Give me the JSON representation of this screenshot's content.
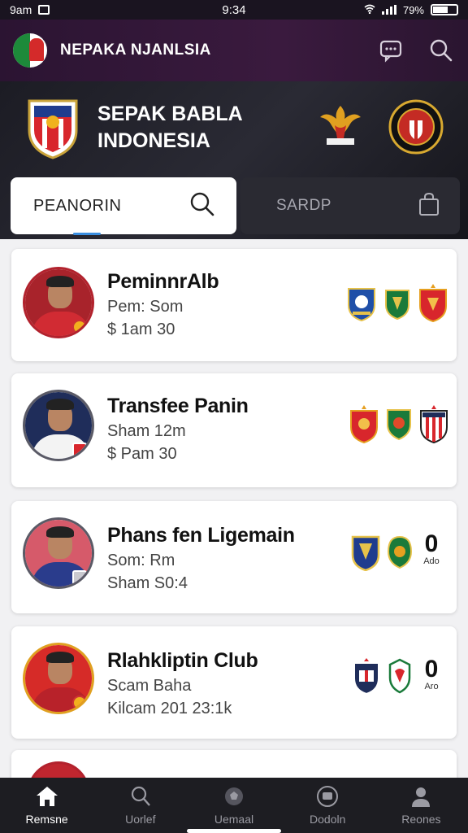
{
  "status_bar": {
    "carrier": "9am",
    "time": "9:34",
    "battery": "79%"
  },
  "app_bar": {
    "title": "NEPAKA NJANLSIA",
    "logo_icon": "soccer-league-logo",
    "actions": [
      "chat-icon",
      "search-icon"
    ]
  },
  "hero": {
    "title_line1": "SEPAK BABLA",
    "title_line2": "INDONESIA",
    "crest_icon": "club-crest-icon",
    "garuda_icon": "garuda-icon",
    "seal_icon": "federation-seal-icon"
  },
  "tabs": {
    "search_tab": {
      "label": "PEANORIN",
      "icon": "search-icon"
    },
    "second_tab": {
      "label": "SARDP",
      "icon": "bag-icon"
    }
  },
  "players": [
    {
      "name": "PeminnrAlb",
      "line1": "Pem: Som",
      "line2": "$ 1am 30",
      "avatar_colors": [
        "#c0262f",
        "#c0262f"
      ],
      "clubs": [
        "club-blue",
        "club-green",
        "club-red"
      ],
      "score": ""
    },
    {
      "name": "Transfee Panin",
      "line1": "Sham 12m",
      "line2": "$ Pam 30",
      "avatar_colors": [
        "#1f2d5a",
        "#f3f3f3"
      ],
      "clubs": [
        "club-red",
        "club-green",
        "club-striped"
      ],
      "score": ""
    },
    {
      "name": "Phans fen Ligemain",
      "line1": "Som: Rm",
      "line2": "Sham S0:4",
      "avatar_colors": [
        "#d65a6a",
        "#2a3c8c"
      ],
      "clubs": [
        "club-gold",
        "club-green"
      ],
      "score": "0",
      "score_sub": "Ado"
    },
    {
      "name": "Rlahkliptin Club",
      "line1": "Scam Baha",
      "line2": "Kilcam 201 23:1k",
      "avatar_colors": [
        "#d62b28",
        "#c0262f"
      ],
      "clubs": [
        "club-navy",
        "club-white"
      ],
      "score": "0",
      "score_sub": "Aro"
    }
  ],
  "bottom_nav": [
    {
      "label": "Remsne",
      "icon": "home-icon",
      "active": true
    },
    {
      "label": "Uorlef",
      "icon": "person-search-icon",
      "active": false
    },
    {
      "label": "Uemaal",
      "icon": "ball-icon",
      "active": false
    },
    {
      "label": "Dodoln",
      "icon": "chat-icon",
      "active": false
    },
    {
      "label": "Reones",
      "icon": "profile-icon",
      "active": false
    }
  ],
  "colors": {
    "app_bar": "#2b1432",
    "hero": "#1c1c24",
    "accent": "#3a8ee0",
    "nav": "#1d1d22"
  }
}
